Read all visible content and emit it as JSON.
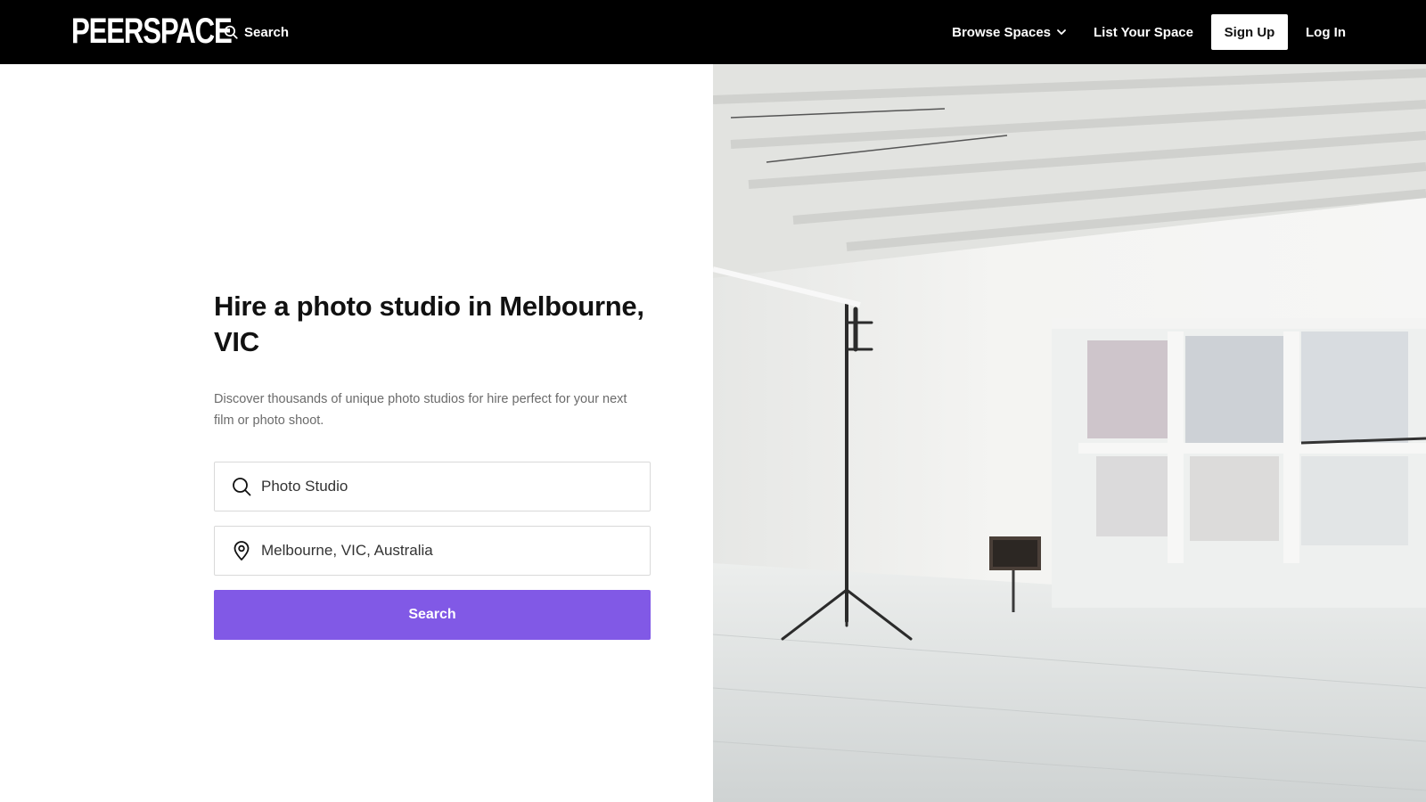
{
  "header": {
    "logo": "PEERSPACE",
    "search_label": "Search",
    "browse_label": "Browse Spaces",
    "list_space_label": "List Your Space",
    "signup_label": "Sign Up",
    "login_label": "Log In"
  },
  "hero": {
    "title": "Hire a photo studio in Melbourne, VIC",
    "subtitle": "Discover thousands of unique photo studios for hire perfect for your next film or photo shoot.",
    "activity_value": "Photo Studio",
    "location_value": "Melbourne, VIC, Australia",
    "search_button": "Search"
  },
  "icons": {
    "nav_search": "search-icon",
    "browse_chevron": "chevron-down-icon",
    "activity": "search-icon",
    "location": "map-pin-icon"
  },
  "colors": {
    "header_bg": "#000000",
    "accent": "#8159e6"
  }
}
